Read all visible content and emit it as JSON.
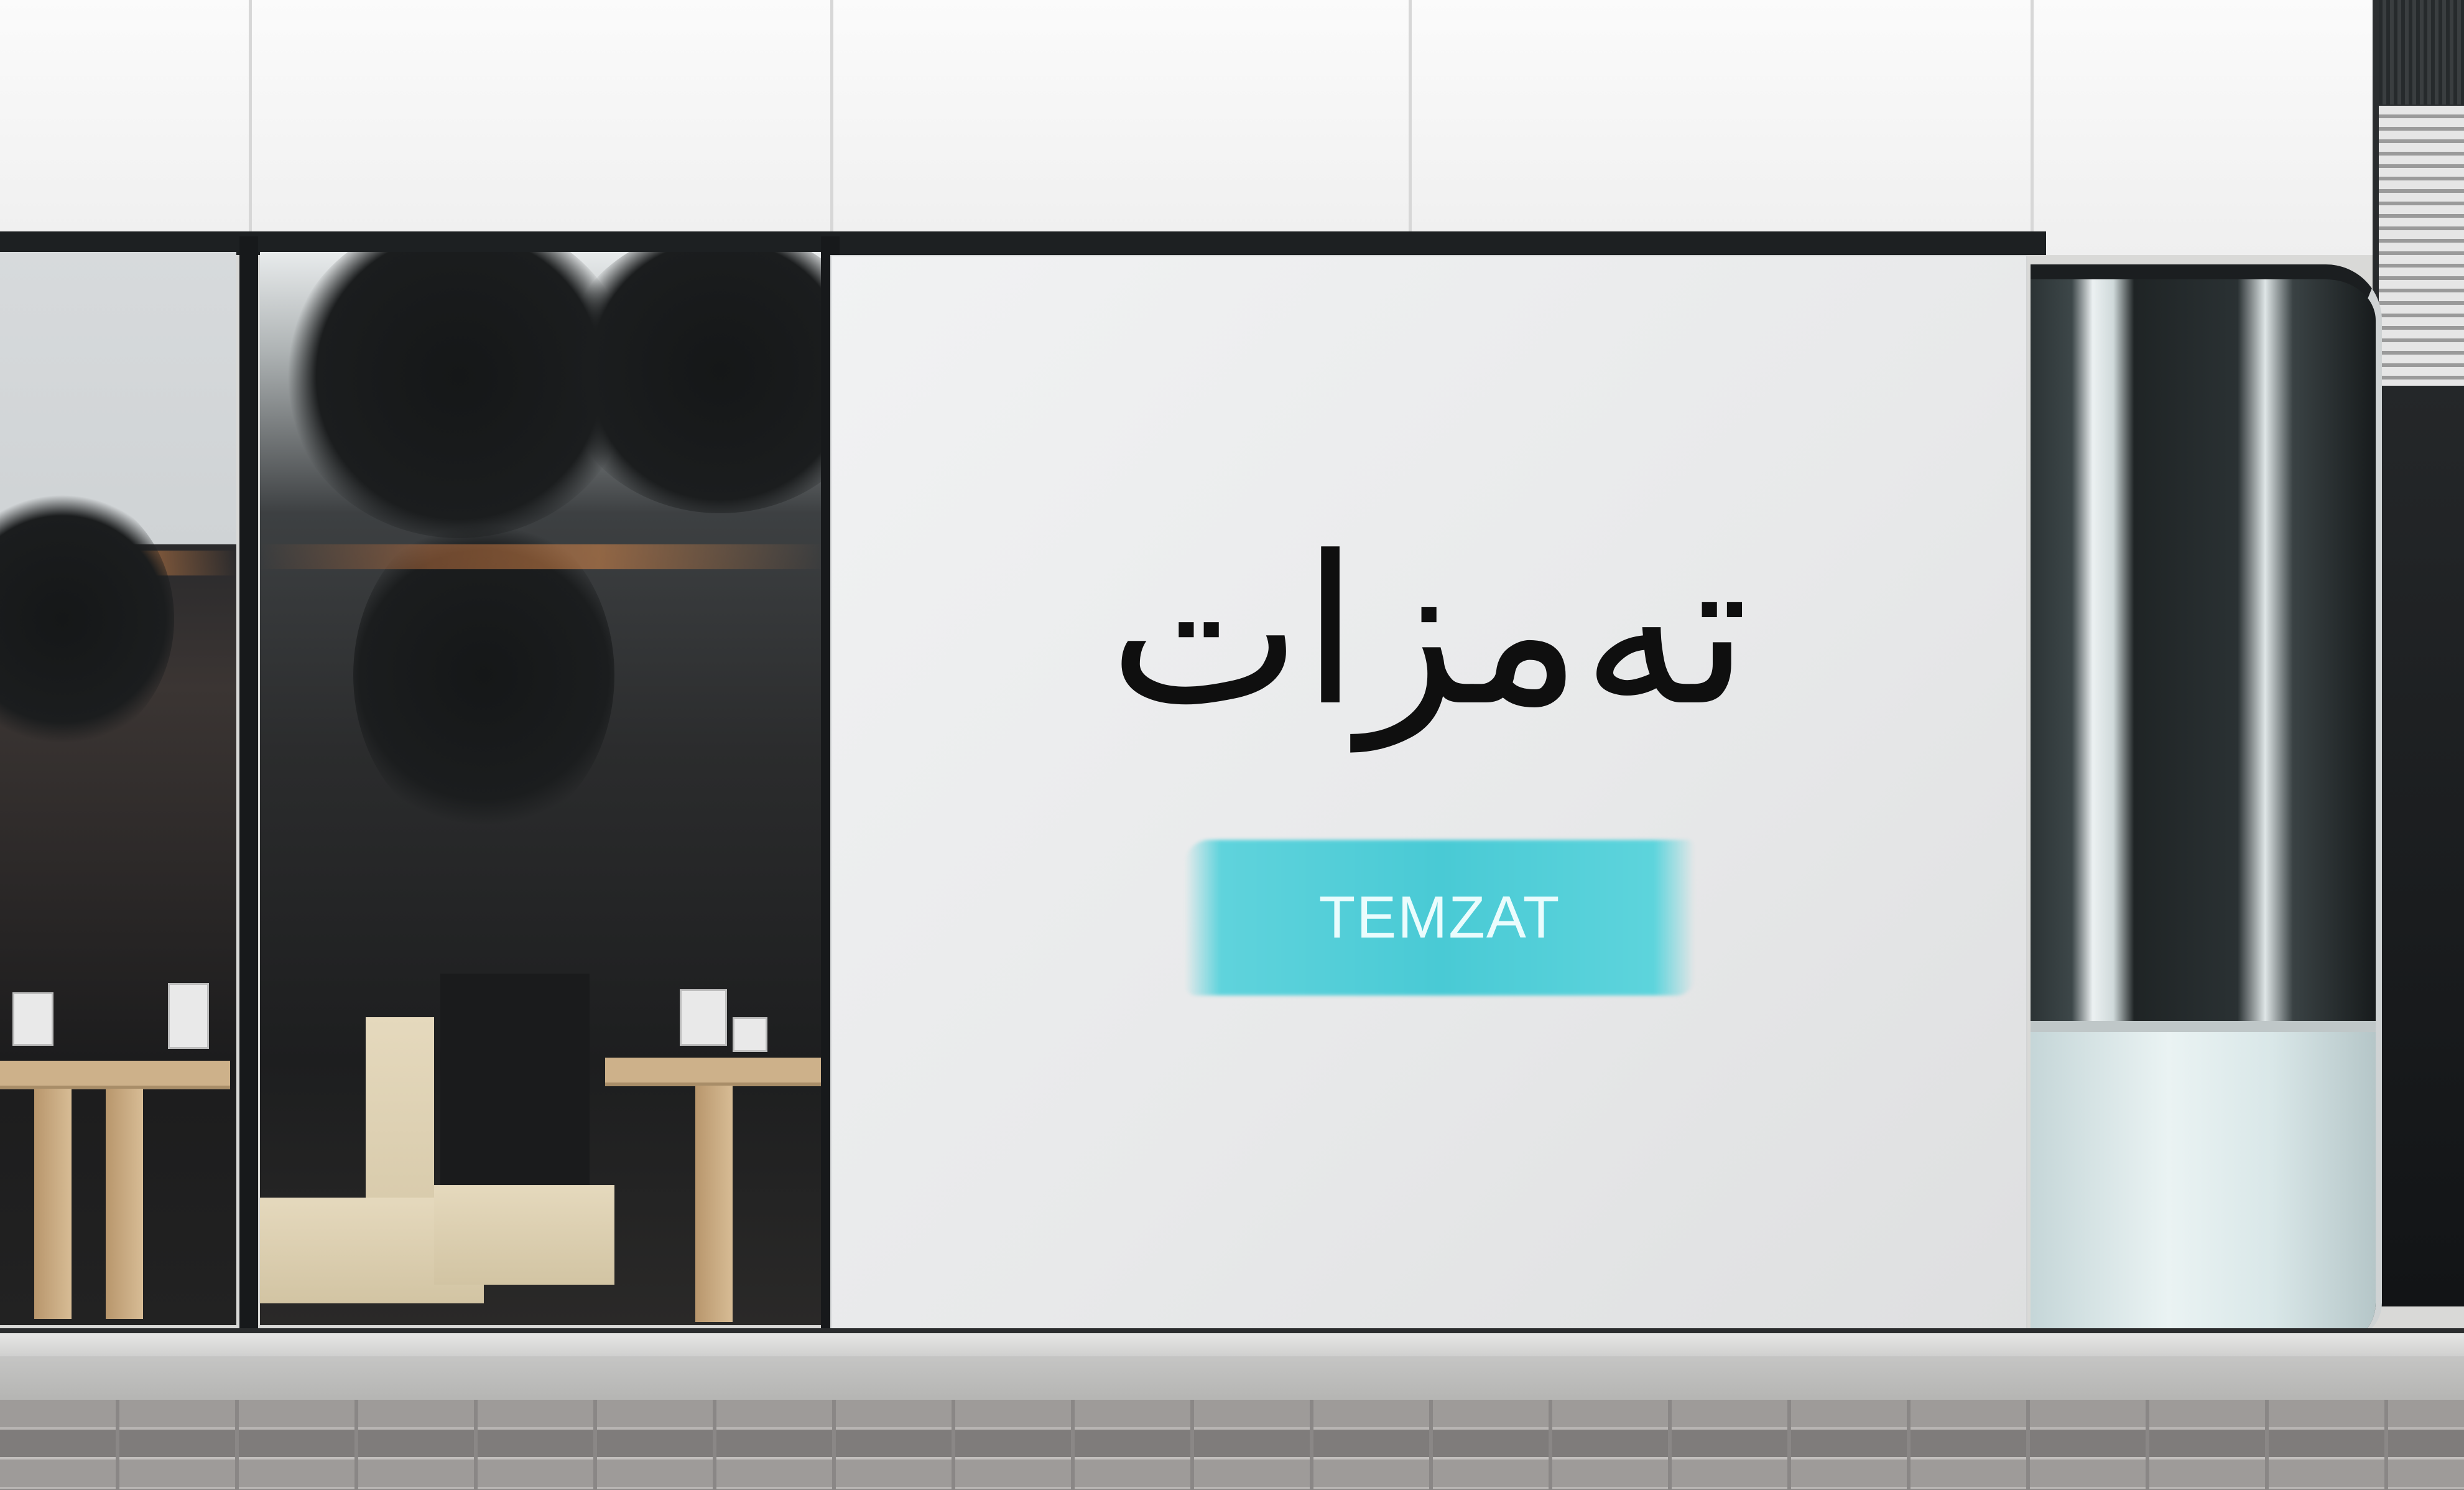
{
  "scene": {
    "description_free": true
  },
  "sign": {
    "arabic_text": "تەمزات",
    "latin_text": "TEMZAT"
  },
  "colors": {
    "brush_accent": "#4ccbd6",
    "sign_panel": "#ebeced",
    "logo_ink": "#0f0f0f"
  }
}
